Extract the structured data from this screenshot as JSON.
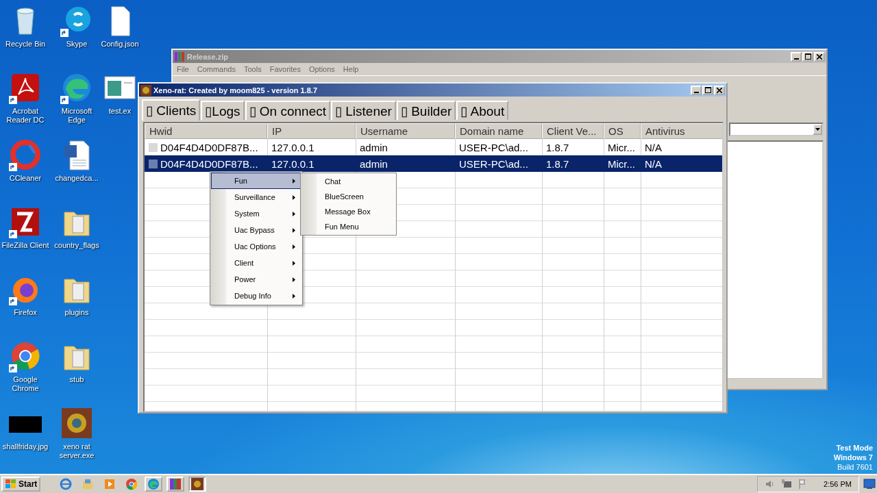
{
  "desktop_icons": [
    {
      "label": "Recycle Bin",
      "kind": "recycle",
      "shortcut": false
    },
    {
      "label": "Skype",
      "kind": "skype",
      "shortcut": true
    },
    {
      "label": "Config.json",
      "kind": "file",
      "shortcut": false
    },
    {
      "label": "Acrobat Reader DC",
      "kind": "acrobat",
      "shortcut": true
    },
    {
      "label": "Microsoft Edge",
      "kind": "edge",
      "shortcut": true
    },
    {
      "label": "test.ex",
      "kind": "exe",
      "shortcut": false
    },
    {
      "label": "CCleaner",
      "kind": "ccleaner",
      "shortcut": true
    },
    {
      "label": "changedca...",
      "kind": "word",
      "shortcut": false
    },
    {
      "label": "FileZilla Client",
      "kind": "filezilla",
      "shortcut": true
    },
    {
      "label": "country_flags",
      "kind": "folder",
      "shortcut": false
    },
    {
      "label": "Firefox",
      "kind": "firefox",
      "shortcut": true
    },
    {
      "label": "plugins",
      "kind": "folder",
      "shortcut": false
    },
    {
      "label": "Google Chrome",
      "kind": "chrome",
      "shortcut": true
    },
    {
      "label": "stub",
      "kind": "folder",
      "shortcut": false
    },
    {
      "label": "shallfriday.jpg",
      "kind": "blackimage",
      "shortcut": false
    },
    {
      "label": "xeno rat server.exe",
      "kind": "xeno",
      "shortcut": false
    }
  ],
  "winrar_window": {
    "title": "Release.zip",
    "menu": [
      "File",
      "Commands",
      "Tools",
      "Favorites",
      "Options",
      "Help"
    ]
  },
  "xeno_window": {
    "title": "Xeno-rat: Created by moom825 - version 1.8.7",
    "tabs": [
      {
        "label": "▯ Clients",
        "selected": true
      },
      {
        "label": "▯Logs",
        "selected": false
      },
      {
        "label": "▯ On connect",
        "selected": false
      },
      {
        "label": "▯ Listener",
        "selected": false
      },
      {
        "label": "▯ Builder",
        "selected": false
      },
      {
        "label": "▯ About",
        "selected": false
      }
    ],
    "table": {
      "columns": [
        "Hwid",
        "IP",
        "Username",
        "Domain name",
        "Client Ve...",
        "OS",
        "Antivirus"
      ],
      "rows": [
        {
          "cells": [
            "D04F4D4D0DF87B...",
            "127.0.0.1",
            "admin",
            "USER-PC\\ad...",
            "1.8.7",
            "Micr...",
            "N/A"
          ],
          "selected": false
        },
        {
          "cells": [
            "D04F4D4D0DF87B...",
            "127.0.0.1",
            "admin",
            "USER-PC\\ad...",
            "1.8.7",
            "Micr...",
            "N/A"
          ],
          "selected": true
        }
      ]
    }
  },
  "context_menu": {
    "items": [
      {
        "label": "Fun",
        "selected": true
      },
      {
        "label": "Surveillance",
        "selected": false
      },
      {
        "label": "System",
        "selected": false
      },
      {
        "label": "Uac Bypass",
        "selected": false
      },
      {
        "label": "Uac Options",
        "selected": false
      },
      {
        "label": "Client",
        "selected": false
      },
      {
        "label": "Power",
        "selected": false
      },
      {
        "label": "Debug Info",
        "selected": false
      }
    ],
    "submenu": [
      "Chat",
      "BlueScreen",
      "Message Box",
      "Fun Menu"
    ]
  },
  "os_watermark": [
    "Test Mode",
    "Windows 7",
    "Build 7601"
  ],
  "taskbar": {
    "start": "Start",
    "items": [
      {
        "kind": "ie",
        "open": false,
        "selected": false
      },
      {
        "kind": "explorer",
        "open": false,
        "selected": false
      },
      {
        "kind": "media",
        "open": false,
        "selected": false
      },
      {
        "kind": "chrome",
        "open": false,
        "selected": false
      },
      {
        "kind": "edge",
        "open": true,
        "selected": false
      },
      {
        "kind": "winrar",
        "open": true,
        "selected": false
      },
      {
        "kind": "xeno",
        "open": true,
        "selected": true
      }
    ],
    "clock": "2:56 PM"
  }
}
